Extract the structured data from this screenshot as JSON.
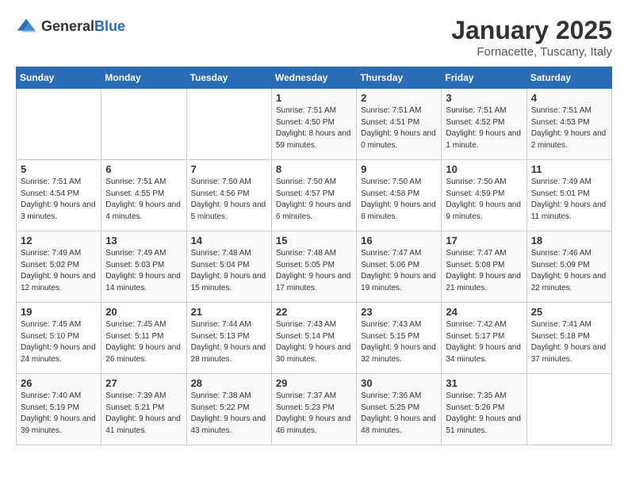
{
  "logo": {
    "text_general": "General",
    "text_blue": "Blue"
  },
  "title": "January 2025",
  "subtitle": "Fornacette, Tuscany, Italy",
  "weekdays": [
    "Sunday",
    "Monday",
    "Tuesday",
    "Wednesday",
    "Thursday",
    "Friday",
    "Saturday"
  ],
  "weeks": [
    [
      {
        "day": "",
        "info": ""
      },
      {
        "day": "",
        "info": ""
      },
      {
        "day": "",
        "info": ""
      },
      {
        "day": "1",
        "info": "Sunrise: 7:51 AM\nSunset: 4:50 PM\nDaylight: 8 hours and 59 minutes."
      },
      {
        "day": "2",
        "info": "Sunrise: 7:51 AM\nSunset: 4:51 PM\nDaylight: 9 hours and 0 minutes."
      },
      {
        "day": "3",
        "info": "Sunrise: 7:51 AM\nSunset: 4:52 PM\nDaylight: 9 hours and 1 minute."
      },
      {
        "day": "4",
        "info": "Sunrise: 7:51 AM\nSunset: 4:53 PM\nDaylight: 9 hours and 2 minutes."
      }
    ],
    [
      {
        "day": "5",
        "info": "Sunrise: 7:51 AM\nSunset: 4:54 PM\nDaylight: 9 hours and 3 minutes."
      },
      {
        "day": "6",
        "info": "Sunrise: 7:51 AM\nSunset: 4:55 PM\nDaylight: 9 hours and 4 minutes."
      },
      {
        "day": "7",
        "info": "Sunrise: 7:50 AM\nSunset: 4:56 PM\nDaylight: 9 hours and 5 minutes."
      },
      {
        "day": "8",
        "info": "Sunrise: 7:50 AM\nSunset: 4:57 PM\nDaylight: 9 hours and 6 minutes."
      },
      {
        "day": "9",
        "info": "Sunrise: 7:50 AM\nSunset: 4:58 PM\nDaylight: 9 hours and 8 minutes."
      },
      {
        "day": "10",
        "info": "Sunrise: 7:50 AM\nSunset: 4:59 PM\nDaylight: 9 hours and 9 minutes."
      },
      {
        "day": "11",
        "info": "Sunrise: 7:49 AM\nSunset: 5:01 PM\nDaylight: 9 hours and 11 minutes."
      }
    ],
    [
      {
        "day": "12",
        "info": "Sunrise: 7:49 AM\nSunset: 5:02 PM\nDaylight: 9 hours and 12 minutes."
      },
      {
        "day": "13",
        "info": "Sunrise: 7:49 AM\nSunset: 5:03 PM\nDaylight: 9 hours and 14 minutes."
      },
      {
        "day": "14",
        "info": "Sunrise: 7:48 AM\nSunset: 5:04 PM\nDaylight: 9 hours and 15 minutes."
      },
      {
        "day": "15",
        "info": "Sunrise: 7:48 AM\nSunset: 5:05 PM\nDaylight: 9 hours and 17 minutes."
      },
      {
        "day": "16",
        "info": "Sunrise: 7:47 AM\nSunset: 5:06 PM\nDaylight: 9 hours and 19 minutes."
      },
      {
        "day": "17",
        "info": "Sunrise: 7:47 AM\nSunset: 5:08 PM\nDaylight: 9 hours and 21 minutes."
      },
      {
        "day": "18",
        "info": "Sunrise: 7:46 AM\nSunset: 5:09 PM\nDaylight: 9 hours and 22 minutes."
      }
    ],
    [
      {
        "day": "19",
        "info": "Sunrise: 7:45 AM\nSunset: 5:10 PM\nDaylight: 9 hours and 24 minutes."
      },
      {
        "day": "20",
        "info": "Sunrise: 7:45 AM\nSunset: 5:11 PM\nDaylight: 9 hours and 26 minutes."
      },
      {
        "day": "21",
        "info": "Sunrise: 7:44 AM\nSunset: 5:13 PM\nDaylight: 9 hours and 28 minutes."
      },
      {
        "day": "22",
        "info": "Sunrise: 7:43 AM\nSunset: 5:14 PM\nDaylight: 9 hours and 30 minutes."
      },
      {
        "day": "23",
        "info": "Sunrise: 7:43 AM\nSunset: 5:15 PM\nDaylight: 9 hours and 32 minutes."
      },
      {
        "day": "24",
        "info": "Sunrise: 7:42 AM\nSunset: 5:17 PM\nDaylight: 9 hours and 34 minutes."
      },
      {
        "day": "25",
        "info": "Sunrise: 7:41 AM\nSunset: 5:18 PM\nDaylight: 9 hours and 37 minutes."
      }
    ],
    [
      {
        "day": "26",
        "info": "Sunrise: 7:40 AM\nSunset: 5:19 PM\nDaylight: 9 hours and 39 minutes."
      },
      {
        "day": "27",
        "info": "Sunrise: 7:39 AM\nSunset: 5:21 PM\nDaylight: 9 hours and 41 minutes."
      },
      {
        "day": "28",
        "info": "Sunrise: 7:38 AM\nSunset: 5:22 PM\nDaylight: 9 hours and 43 minutes."
      },
      {
        "day": "29",
        "info": "Sunrise: 7:37 AM\nSunset: 5:23 PM\nDaylight: 9 hours and 46 minutes."
      },
      {
        "day": "30",
        "info": "Sunrise: 7:36 AM\nSunset: 5:25 PM\nDaylight: 9 hours and 48 minutes."
      },
      {
        "day": "31",
        "info": "Sunrise: 7:35 AM\nSunset: 5:26 PM\nDaylight: 9 hours and 51 minutes."
      },
      {
        "day": "",
        "info": ""
      }
    ]
  ]
}
